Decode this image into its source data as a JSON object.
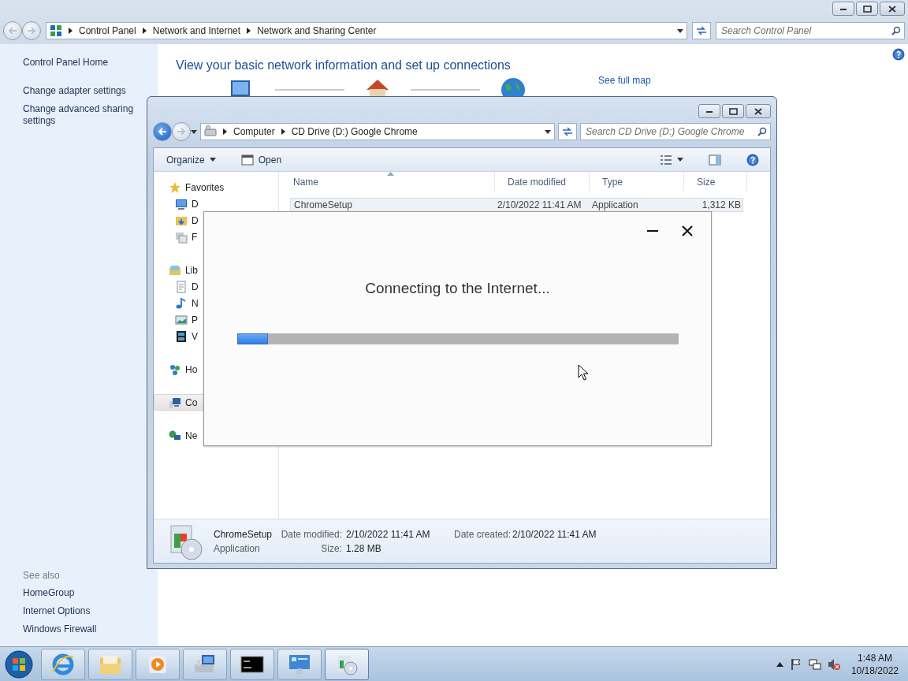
{
  "control_panel": {
    "breadcrumb": [
      "Control Panel",
      "Network and Internet",
      "Network and Sharing Center"
    ],
    "search": {
      "placeholder": "Search Control Panel"
    },
    "sidebar": {
      "items": [
        "Control Panel Home",
        "Change adapter settings",
        "Change advanced sharing settings"
      ],
      "see_also_heading": "See also",
      "see_also": [
        "HomeGroup",
        "Internet Options",
        "Windows Firewall"
      ]
    },
    "heading": "View your basic network information and set up connections",
    "map_link": "See full map"
  },
  "explorer": {
    "breadcrumb": [
      "Computer",
      "CD Drive (D:) Google Chrome"
    ],
    "search": {
      "placeholder": "Search CD Drive (D:) Google Chrome"
    },
    "toolbar": [
      "Organize",
      "Open"
    ],
    "nav": [
      {
        "label": "Favorites",
        "selected": false,
        "children": [
          {
            "label": "D",
            "selected": false
          },
          {
            "label": "D",
            "selected": false
          },
          {
            "label": "F",
            "selected": false
          }
        ]
      },
      {
        "label": "Lib",
        "selected": false,
        "children": [
          {
            "label": "D",
            "selected": false
          },
          {
            "label": "N",
            "selected": false
          },
          {
            "label": "P",
            "selected": false
          },
          {
            "label": "V",
            "selected": false
          }
        ]
      },
      {
        "label": "Ho",
        "selected": false
      },
      {
        "label": "Co",
        "selected": true
      },
      {
        "label": "Ne",
        "selected": false
      }
    ],
    "columns": [
      "Name",
      "Date modified",
      "Type",
      "Size"
    ],
    "rows": [
      {
        "selected": true,
        "cells": [
          "ChromeSetup",
          "2/10/2022 11:41 AM",
          "Application",
          "1,312 KB"
        ]
      }
    ],
    "details": {
      "name": "ChromeSetup",
      "type": "Application",
      "fields": [
        {
          "label": "Date modified:",
          "value": "2/10/2022 11:41 AM"
        },
        {
          "label": "Date created:",
          "value": "2/10/2022 11:41 AM"
        },
        {
          "label": "Size:",
          "value": "1.28 MB"
        }
      ]
    }
  },
  "dialog": {
    "message": "Connecting to the Internet...",
    "progress": {
      "level": 0.07
    }
  },
  "taskbar": {
    "items": [
      {
        "selected": false
      },
      {
        "selected": false
      },
      {
        "selected": false
      },
      {
        "selected": false
      },
      {
        "selected": false
      },
      {
        "selected": false
      },
      {
        "selected": true
      }
    ],
    "time": "1:48 AM",
    "date": "10/18/2022"
  }
}
